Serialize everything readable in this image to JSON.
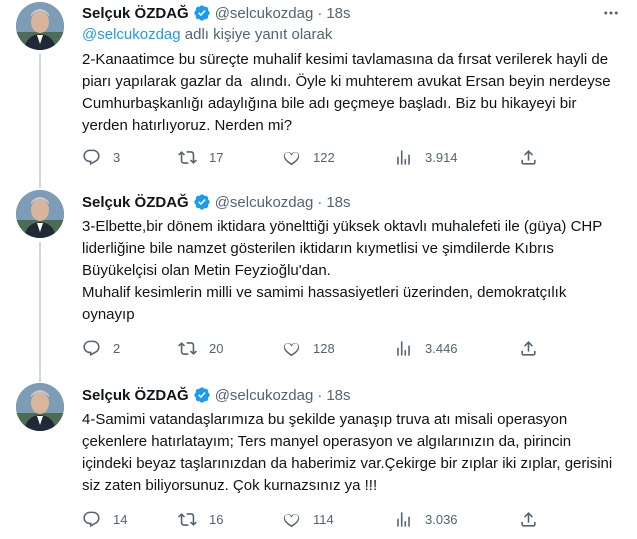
{
  "colors": {
    "accent": "#1d9bf0",
    "text": "#0f1419",
    "muted": "#536471",
    "divider": "#eff3f4"
  },
  "tweets": [
    {
      "name": "Selçuk ÖZDAĞ",
      "handle": "@selcukozdag",
      "dot": "·",
      "time": "18s",
      "reply_mention": "@selcukozdag",
      "reply_suffix": " adlı kişiye yanıt olarak",
      "text": "2-Kanaatimce bu süreçte muhalif kesimi tavlamasına da fırsat verilerek hayli de piarı yapılarak gazlar da  alındı. Öyle ki muhterem avukat Ersan beyin nerdeyse Cumhurbaşkanlığı adaylığına bile adı geçmeye başladı. Biz bu hikayeyi bir yerden hatırlıyoruz. Nerden mi?",
      "replies": "3",
      "retweets": "17",
      "likes": "122",
      "views": "3.914"
    },
    {
      "name": "Selçuk ÖZDAĞ",
      "handle": "@selcukozdag",
      "dot": "·",
      "time": "18s",
      "text": "3-Elbette,bir dönem iktidara yönelttiği yüksek oktavlı muhalefeti ile (güya) CHP liderliğine bile namzet gösterilen iktidarın kıymetlisi ve şimdilerde Kıbrıs Büyükelçisi olan Metin Feyzioğlu'dan.\nMuhalif kesimlerin milli ve samimi hassasiyetleri üzerinden, demokratçılık oynayıp",
      "replies": "2",
      "retweets": "20",
      "likes": "128",
      "views": "3.446"
    },
    {
      "name": "Selçuk ÖZDAĞ",
      "handle": "@selcukozdag",
      "dot": "·",
      "time": "18s",
      "text": "4-Samimi vatandaşlarımıza bu şekilde yanaşıp truva atı misali operasyon çekenlere hatırlatayım; Ters manyel operasyon ve algılarınızın da, pirincin içindeki beyaz taşlarınızdan da haberimiz var.Çekirge bir zıplar iki zıplar, gerisini siz zaten biliyorsunuz. Çok kurnazsınız ya !!!",
      "replies": "14",
      "retweets": "16",
      "likes": "114",
      "views": "3.036"
    }
  ]
}
